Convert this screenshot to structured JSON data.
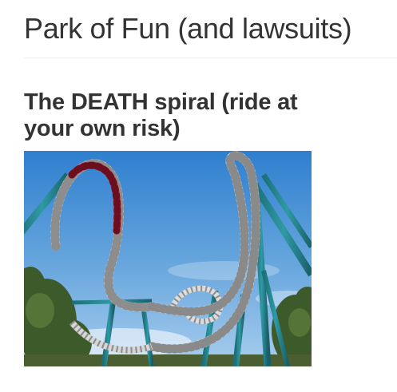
{
  "page": {
    "title": "Park of Fun (and lawsuits)"
  },
  "section": {
    "heading": "The DEATH spiral (ride at your own risk)"
  }
}
